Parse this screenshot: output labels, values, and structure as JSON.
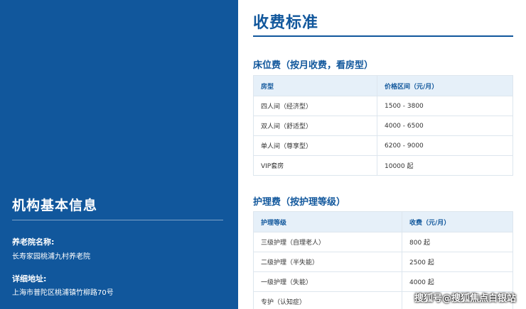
{
  "sidebar": {
    "title": "机构基本信息",
    "name_label": "养老院名称:",
    "name_value": "长寿家园桃浦九村养老院",
    "address_label": "详细地址:",
    "address_value": "上海市普陀区桃浦镇竹柳路70号"
  },
  "main": {
    "title": "收费标准",
    "bed_section": {
      "title": "床位费（按月收费，看房型）",
      "headers": [
        "房型",
        "价格区间（元/月）"
      ],
      "rows": [
        [
          "四人间（经济型）",
          "1500 - 3800"
        ],
        [
          "双人间（舒适型）",
          "4000 - 6500"
        ],
        [
          "单人间（尊享型）",
          "6200 - 9000"
        ],
        [
          "VIP套房",
          "10000 起"
        ]
      ]
    },
    "care_section": {
      "title": "护理费（按护理等级）",
      "headers": [
        "护理等级",
        "收费（元/月）"
      ],
      "rows": [
        [
          "三级护理（自理老人）",
          "800 起"
        ],
        [
          "二级护理（半失能）",
          "2500 起"
        ],
        [
          "一级护理（失能）",
          "4000 起"
        ],
        [
          "专护（认知症）",
          ""
        ]
      ]
    }
  },
  "watermark": "搜狐号@搜狐焦点白银站"
}
